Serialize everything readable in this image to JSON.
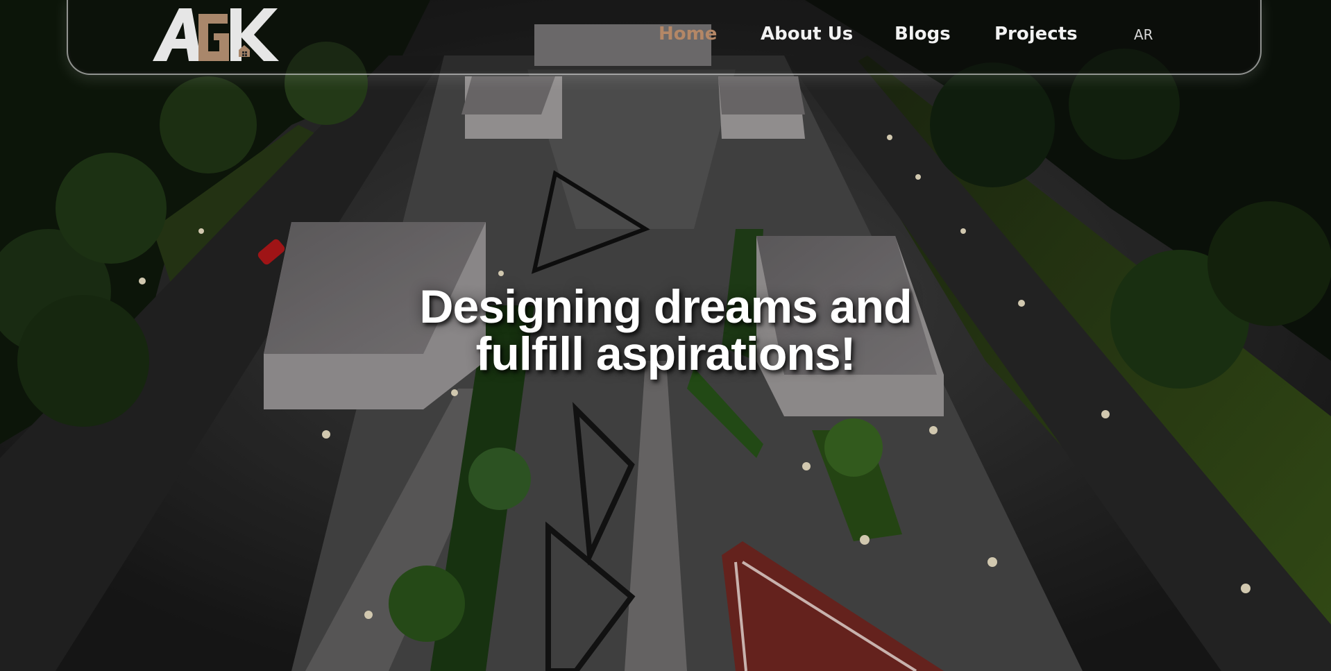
{
  "nav": {
    "logo_text": "AGK",
    "links": [
      {
        "label": "Home",
        "active": true
      },
      {
        "label": "About Us",
        "active": false
      },
      {
        "label": "Blogs",
        "active": false
      },
      {
        "label": "Projects",
        "active": false
      }
    ],
    "language": "AR"
  },
  "hero": {
    "heading_line1": "Designing dreams and",
    "heading_line2": "fulfill aspirations!",
    "background": "night aerial render of landscaped plaza with white buildings, palm trees and street lamps"
  },
  "colors": {
    "accent": "#b48766",
    "nav_text": "#f2f2f2",
    "heading": "#ffffff"
  }
}
